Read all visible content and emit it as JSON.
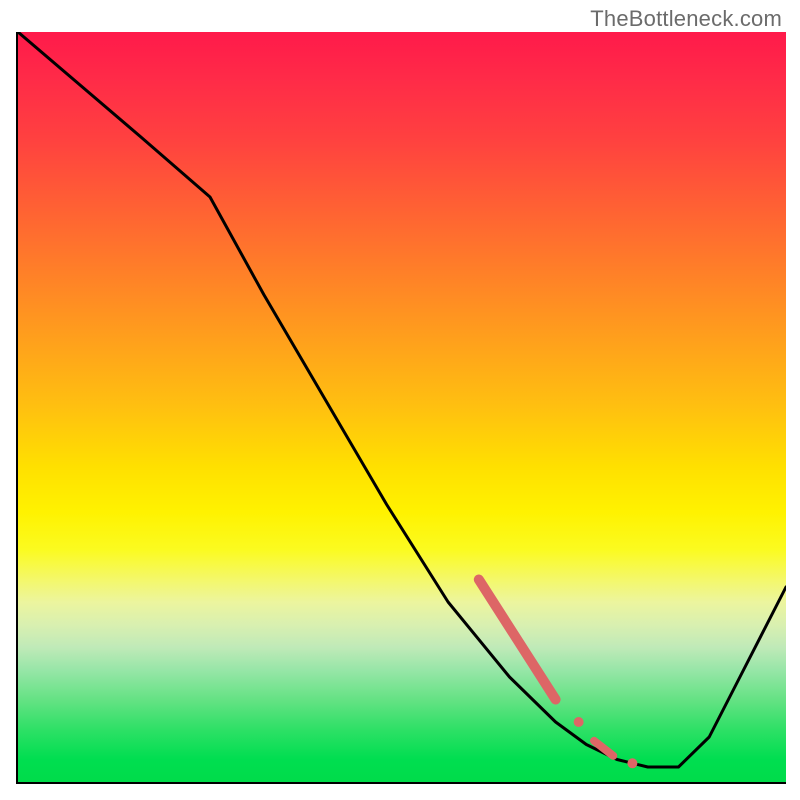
{
  "watermark": "TheBottleneck.com",
  "colors": {
    "curve_stroke": "#000000",
    "marker_fill": "#dd6666",
    "marker_stroke": "#dd6666",
    "gradient_top": "#ff1a4a",
    "gradient_bottom": "#00dc4a"
  },
  "chart_data": {
    "type": "line",
    "title": "",
    "xlabel": "",
    "ylabel": "",
    "xlim": [
      0,
      100
    ],
    "ylim": [
      0,
      100
    ],
    "grid": false,
    "background": "rainbow-gradient-vertical",
    "series": [
      {
        "name": "bottleneck-curve",
        "x": [
          0,
          8,
          16,
          25,
          32,
          40,
          48,
          56,
          64,
          70,
          74,
          78,
          82,
          86,
          90,
          94,
          100
        ],
        "y": [
          100,
          93,
          86,
          78,
          65,
          51,
          37,
          24,
          14,
          8,
          5,
          3,
          2,
          2,
          6,
          14,
          26
        ]
      }
    ],
    "markers": [
      {
        "name": "thick-segment",
        "shape": "line-segment",
        "x0": 60,
        "y0": 27,
        "x1": 70,
        "y1": 11,
        "width": 10
      },
      {
        "name": "dot-upper",
        "shape": "circle",
        "x": 73,
        "y": 8,
        "r": 5
      },
      {
        "name": "mini-segment",
        "shape": "line-segment",
        "x0": 75,
        "y0": 5.5,
        "x1": 77.5,
        "y1": 3.5,
        "width": 8
      },
      {
        "name": "dot-lower",
        "shape": "circle",
        "x": 80,
        "y": 2.5,
        "r": 5
      }
    ],
    "annotations": [
      {
        "text": "TheBottleneck.com",
        "position": "top-right"
      }
    ]
  }
}
